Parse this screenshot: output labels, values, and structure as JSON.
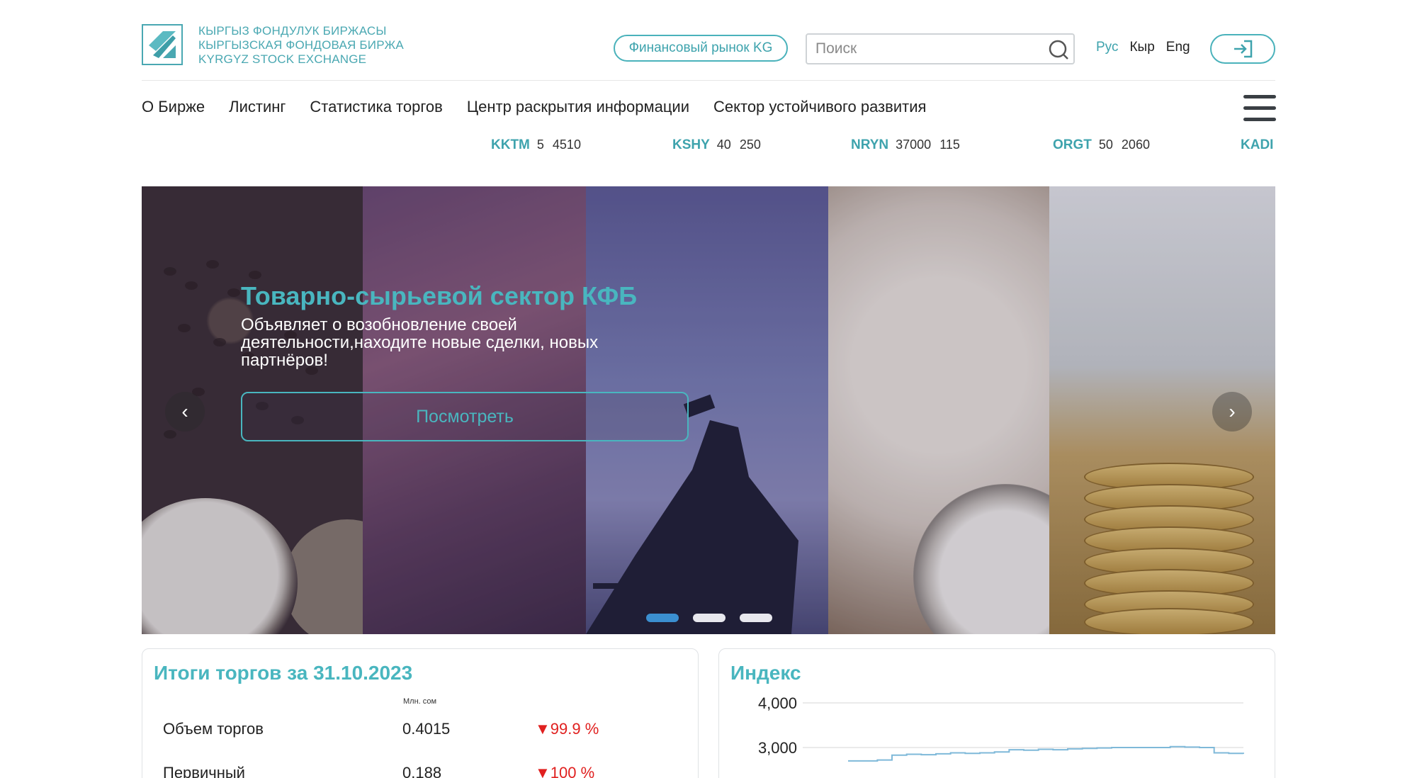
{
  "header": {
    "logo_lines": [
      "КЫРГЫЗ ФОНДУЛУК БИРЖАСЫ",
      "КЫРГЫЗСКАЯ ФОНДОВАЯ БИРЖА",
      "KYRGYZ STOCK EXCHANGE"
    ],
    "fin_market_label": "Финансовый рынок KG",
    "search_placeholder": "Поиск",
    "langs": [
      "Рус",
      "Кыр",
      "Eng"
    ],
    "accent_color": "#49b6bf"
  },
  "nav": {
    "items": [
      "О Бирже",
      "Листинг",
      "Статистика торгов",
      "Центр раскрытия информации",
      "Сектор устойчивого развития"
    ]
  },
  "ticker": [
    {
      "symbol": "KKTM",
      "a": "5",
      "b": "4510"
    },
    {
      "symbol": "KSHY",
      "a": "40",
      "b": "250"
    },
    {
      "symbol": "NRYN",
      "a": "37000",
      "b": "115"
    },
    {
      "symbol": "ORGT",
      "a": "50",
      "b": "2060"
    },
    {
      "symbol": "KADI",
      "a": "",
      "b": ""
    }
  ],
  "slider": {
    "title": "Товарно-сырьевой сектор КФБ",
    "subtitle": "Объявляет о возобновление своей деятельности,находите новые сделки, новых партнёров!",
    "button_label": "Посмотреть",
    "dots_total": 3,
    "active_dot": 0
  },
  "trading": {
    "title": "Итоги торгов за 31.10.2023",
    "unit": "Млн. сом",
    "rows": [
      {
        "label": "Объем торгов",
        "value": "0.4015",
        "change": "▼99.9 %"
      },
      {
        "label": "Первичный",
        "value": "0.188",
        "change": "▼100 %"
      }
    ],
    "negative_color": "#e0201f"
  },
  "index": {
    "title": "Индекс"
  },
  "chart_data": {
    "type": "line",
    "title": "Индекс",
    "xlabel": "",
    "ylabel": "",
    "y_ticks": [
      "4,000",
      "3,000"
    ],
    "ylim": [
      2600,
      4000
    ],
    "grid": true,
    "series": [
      {
        "values": [
          2700,
          2700,
          2720,
          2830,
          2850,
          2840,
          2860,
          2880,
          2870,
          2880,
          2900,
          2950,
          2940,
          2960,
          2950,
          2970,
          2980,
          2990,
          3000,
          3000,
          3000,
          3000,
          3020,
          3010,
          3000,
          2880,
          2870,
          2860
        ]
      }
    ],
    "color": "#7fb9d9"
  }
}
